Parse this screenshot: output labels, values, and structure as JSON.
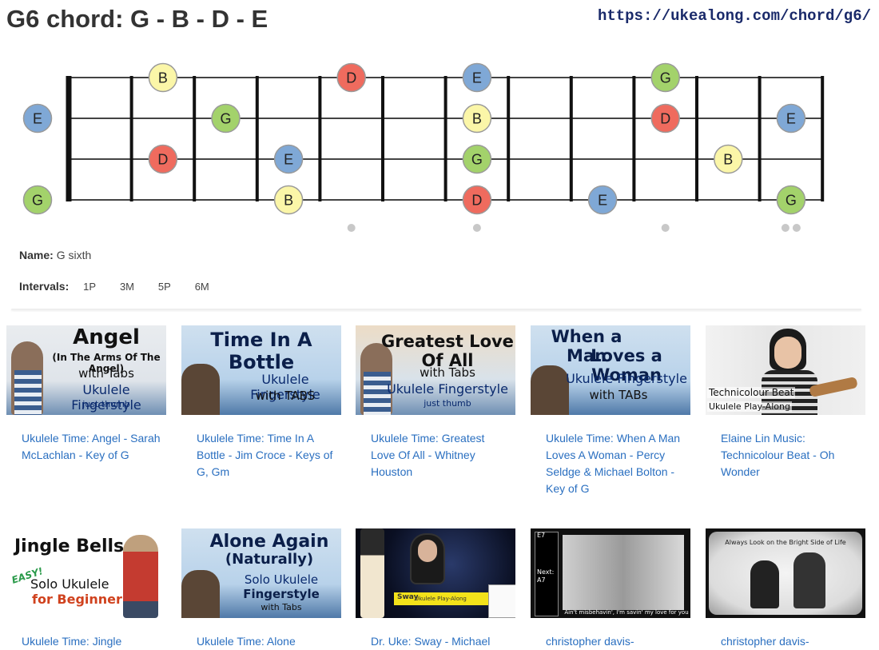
{
  "page": {
    "title": "G6 chord: G - B - D - E",
    "url": "https://ukealong.com/chord/g6/"
  },
  "chord": {
    "name_label": "Name:",
    "name": "G sixth",
    "intervals_label": "Intervals:",
    "intervals": [
      "1P",
      "3M",
      "5P",
      "6M"
    ]
  },
  "fretboard": {
    "strings": [
      "A",
      "E",
      "C",
      "G"
    ],
    "frets": 12,
    "fret_markers": [
      5,
      7,
      10,
      12
    ],
    "note_colors": {
      "G": "#a3d26b",
      "B": "#fbf6a8",
      "D": "#ef6b5e",
      "E": "#7fa8d6"
    },
    "notes": [
      {
        "string": 0,
        "fret": 2,
        "note": "B"
      },
      {
        "string": 0,
        "fret": 5,
        "note": "D"
      },
      {
        "string": 0,
        "fret": 7,
        "note": "E"
      },
      {
        "string": 0,
        "fret": 10,
        "note": "G"
      },
      {
        "string": 1,
        "fret": 0,
        "note": "E"
      },
      {
        "string": 1,
        "fret": 3,
        "note": "G"
      },
      {
        "string": 1,
        "fret": 7,
        "note": "B"
      },
      {
        "string": 1,
        "fret": 10,
        "note": "D"
      },
      {
        "string": 1,
        "fret": 12,
        "note": "E"
      },
      {
        "string": 2,
        "fret": 2,
        "note": "D"
      },
      {
        "string": 2,
        "fret": 4,
        "note": "E"
      },
      {
        "string": 2,
        "fret": 7,
        "note": "G"
      },
      {
        "string": 2,
        "fret": 11,
        "note": "B"
      },
      {
        "string": 3,
        "fret": 0,
        "note": "G"
      },
      {
        "string": 3,
        "fret": 4,
        "note": "B"
      },
      {
        "string": 3,
        "fret": 7,
        "note": "D"
      },
      {
        "string": 3,
        "fret": 9,
        "note": "E"
      },
      {
        "string": 3,
        "fret": 12,
        "note": "G"
      }
    ]
  },
  "videos": [
    {
      "caption": "Ukulele Time: Angel - Sarah McLachlan - Key of G",
      "thumb_lines": [
        "Angel",
        "(In The Arms Of The Angel)",
        "with Tabs",
        "Ukulele Fingerstyle",
        "just thumb"
      ]
    },
    {
      "caption": "Ukulele Time: Time In A Bottle - Jim Croce - Keys of G, Gm",
      "thumb_lines": [
        "Time In A Bottle",
        "Ukulele Fingerstyle",
        "with TABS"
      ]
    },
    {
      "caption": "Ukulele Time: Greatest Love Of All - Whitney Houston",
      "thumb_lines": [
        "Greatest Love Of All",
        "with Tabs",
        "Ukulele Fingerstyle",
        "just thumb"
      ]
    },
    {
      "caption": "Ukulele Time: When A Man Loves A Woman - Percy Seldge & Michael Bolton - Key of G",
      "thumb_lines": [
        "When a Man",
        "Loves a Woman",
        "Ukulele Fingerstyle",
        "with TABs"
      ]
    },
    {
      "caption": "Elaine Lin Music: Technicolour Beat - Oh Wonder",
      "thumb_lines": [
        "Technicolour Beat",
        "Ukulele Play-Along"
      ]
    },
    {
      "caption": "Ukulele Time: Jingle",
      "thumb_lines": [
        "Jingle Bells",
        "EASY!",
        "Solo Ukulele",
        "for Beginner"
      ]
    },
    {
      "caption": "Ukulele Time: Alone",
      "thumb_lines": [
        "Alone Again",
        "(Naturally)",
        "Solo Ukulele",
        "Fingerstyle",
        "with Tabs"
      ]
    },
    {
      "caption": "Dr. Uke: Sway - Michael",
      "thumb_lines": [
        "Sway",
        "Ukulele Play-Along"
      ]
    },
    {
      "caption": "christopher davis-",
      "thumb_lines": [
        "E7",
        "Next:",
        "A7",
        "Ain't misbehavin', I'm savin' my love for you"
      ]
    },
    {
      "caption": "christopher davis-",
      "thumb_lines": [
        "Always Look on the Bright Side of Life"
      ]
    }
  ]
}
